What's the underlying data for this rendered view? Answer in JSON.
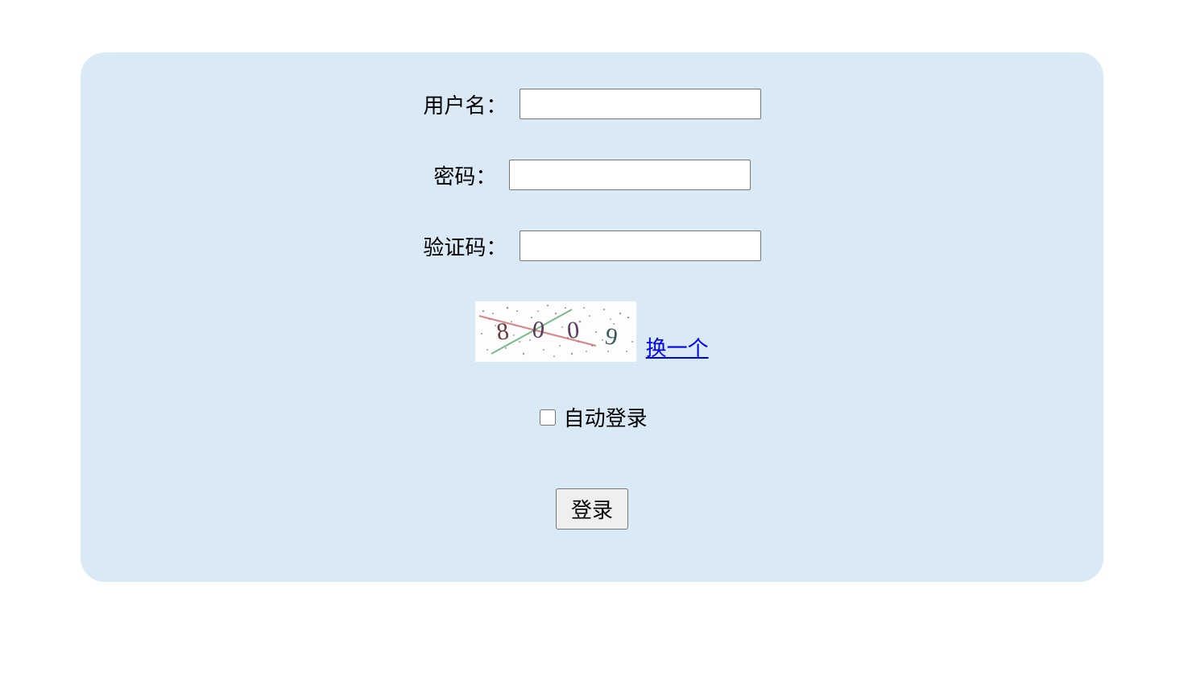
{
  "form": {
    "username_label": "用户名：",
    "username_value": "",
    "password_label": "密码：",
    "password_value": "",
    "captcha_label": "验证码：",
    "captcha_value": "",
    "captcha_digits": "8009",
    "refresh_link_text": "换一个",
    "auto_login_label": "自动登录",
    "auto_login_checked": false,
    "submit_label": "登录"
  },
  "colors": {
    "panel_bg": "#d9e9f5",
    "link": "#0000EE"
  }
}
